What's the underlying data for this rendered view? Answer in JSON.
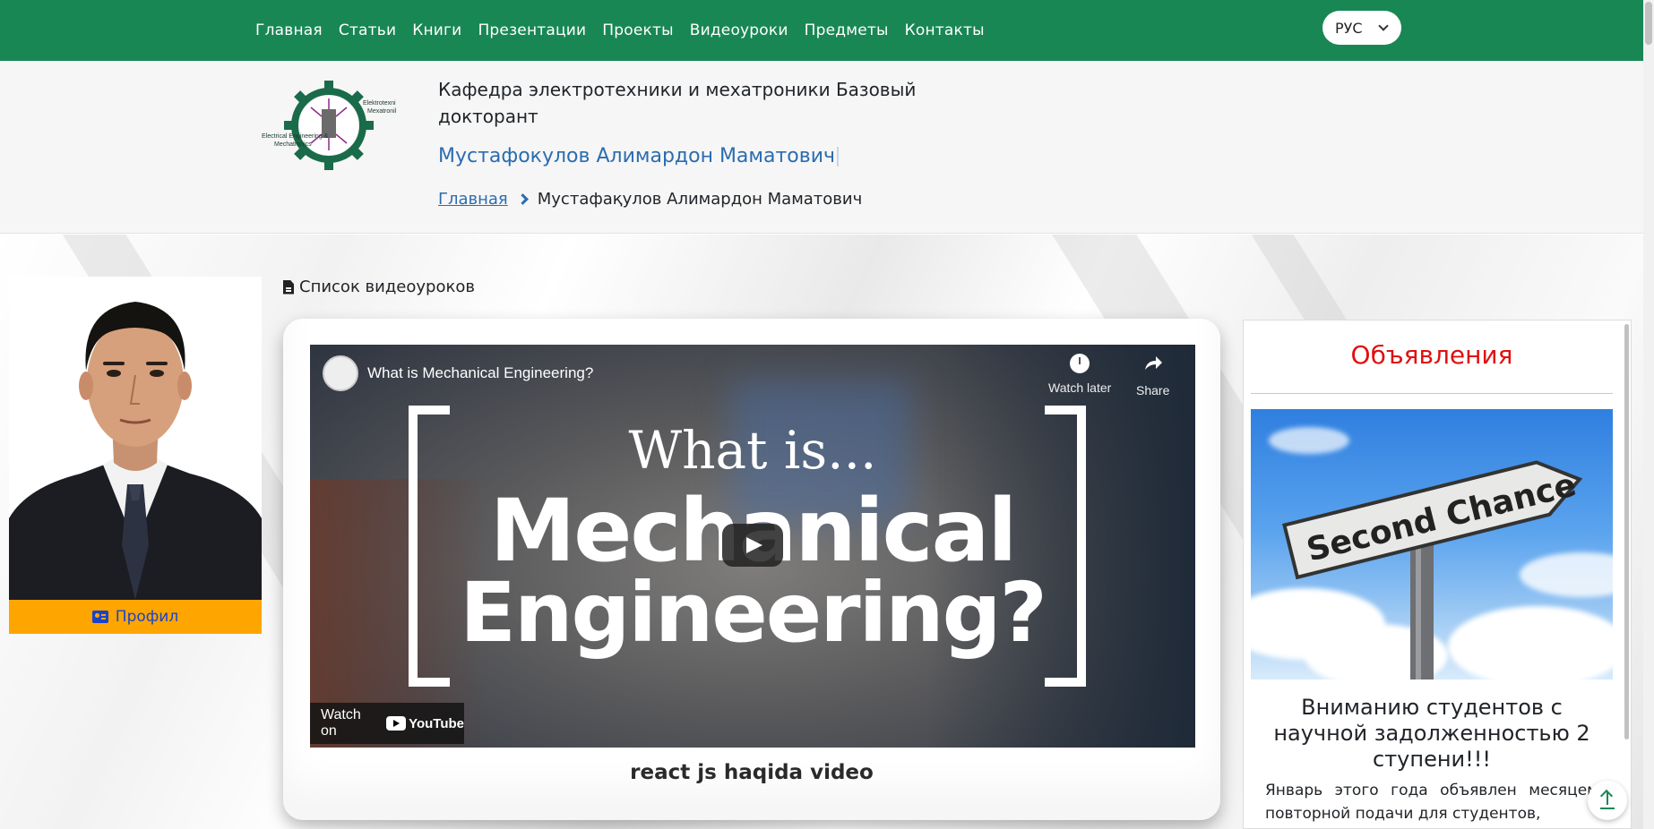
{
  "nav": {
    "items": [
      "Главная",
      "Статьи",
      "Книги",
      "Презентации",
      "Проекты",
      "Видеоуроки",
      "Предметы",
      "Контакты"
    ],
    "language": "РУС"
  },
  "header": {
    "logo_text_top": "Elektrotexnika va Mexatronika",
    "logo_text_left": "Electrical Engineering & Mechatronics",
    "department": "Кафедра электротехники и мехатроники Базовый докторант",
    "person_name": "Мустафокулов Алимардон Маматович",
    "breadcrumb": {
      "home": "Главная",
      "current": "Мустафақулов Алимардон Маматович"
    }
  },
  "profile": {
    "button_label": "Профил"
  },
  "videos": {
    "list_title": "Список видеоуроков",
    "player": {
      "title": "What is Mechanical Engineering?",
      "watch_later": "Watch later",
      "share": "Share",
      "overlay_line1": "What is...",
      "overlay_line2": "Mechanical",
      "overlay_line3": "Engineering?",
      "watch_on": "Watch on",
      "youtube": "YouTube"
    },
    "caption": "react js haqida video"
  },
  "announcements": {
    "title": "Объявления",
    "image_sign_text": "Second Chance",
    "item_heading": "Вниманию студентов с научной задолженностью 2 ступени!!!",
    "item_body": "Январь этого года объявлен месяцем повторной подачи для студентов,"
  },
  "colors": {
    "nav_bg": "#198754",
    "link": "#2b6cb0",
    "profile_button": "#ffa500",
    "announcement_title": "#e01010"
  }
}
